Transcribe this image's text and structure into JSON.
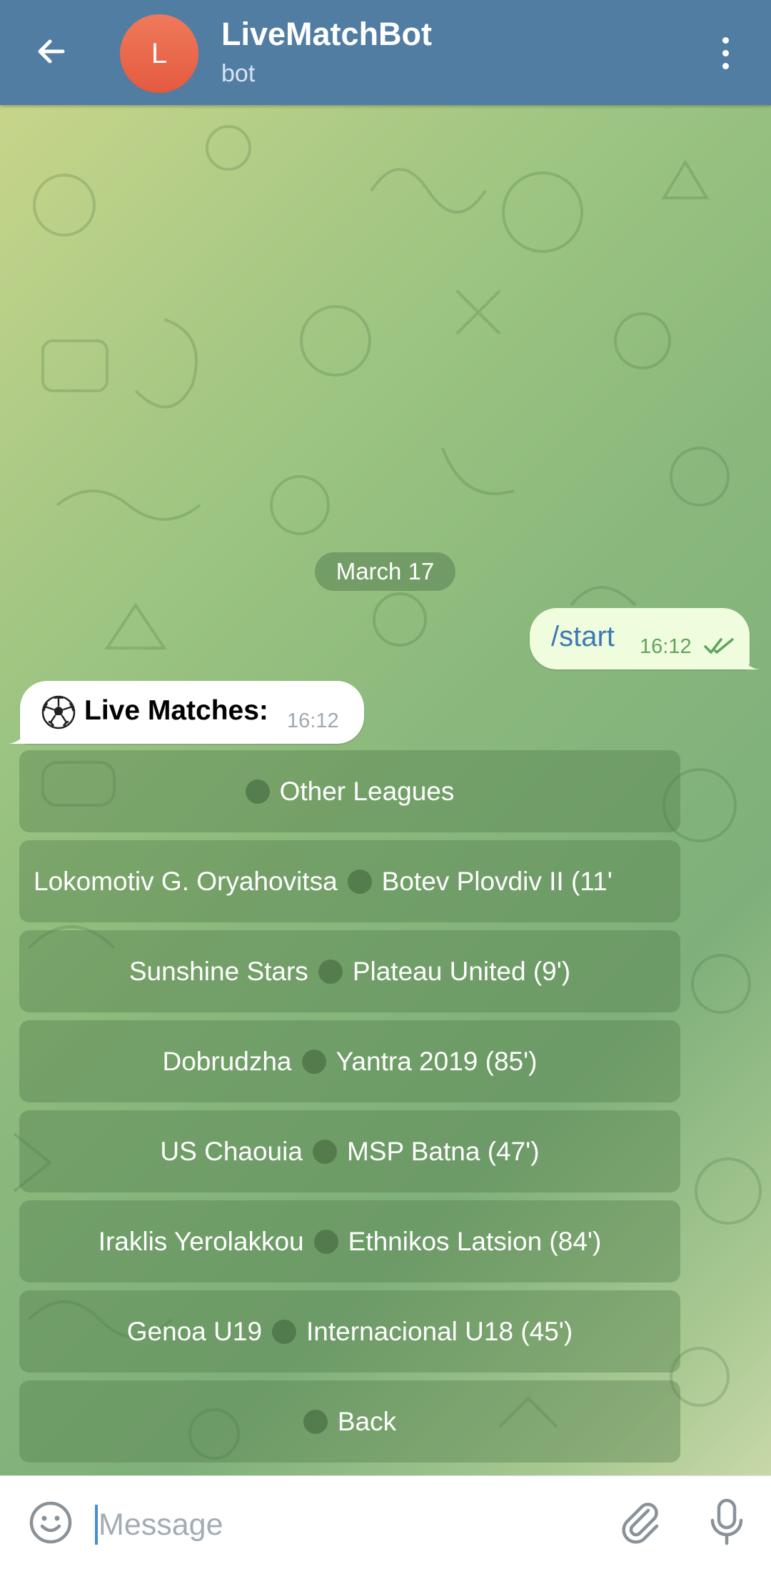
{
  "header": {
    "back_icon": "arrow-left-icon",
    "avatar_letter": "L",
    "title": "LiveMatchBot",
    "subtitle": "bot",
    "menu_icon": "vertical-dots-icon"
  },
  "colors": {
    "header_bg": "#517da2",
    "avatar": "#e45a3f",
    "outgoing_bubble": "#effdde",
    "outgoing_text": "#3b7ab1",
    "read_check": "#5fa45b"
  },
  "chat": {
    "date_label": "March 17",
    "outgoing": {
      "text": "/start",
      "time": "16:12",
      "status_icon": "double-check-icon"
    },
    "incoming": {
      "icon": "soccer-ball-icon",
      "text": "Live Matches:",
      "time": "16:12"
    },
    "keyboard": [
      {
        "left": "",
        "right": "Other Leagues"
      },
      {
        "left": "Lokomotiv G. Oryahovitsa",
        "right": "Botev Plovdiv II (11'"
      },
      {
        "left": "Sunshine Stars",
        "right": "Plateau United (9')"
      },
      {
        "left": "Dobrudzha",
        "right": "Yantra 2019 (85')"
      },
      {
        "left": "US Chaouia",
        "right": "MSP Batna (47')"
      },
      {
        "left": "Iraklis Yerolakkou",
        "right": "Ethnikos Latsion (84')"
      },
      {
        "left": "Genoa U19",
        "right": "Internacional U18 (45')"
      },
      {
        "left": "",
        "right": "Back"
      }
    ]
  },
  "input": {
    "placeholder": "Message",
    "value": "",
    "emoji_icon": "smiley-icon",
    "attach_icon": "paperclip-icon",
    "mic_icon": "microphone-icon"
  }
}
